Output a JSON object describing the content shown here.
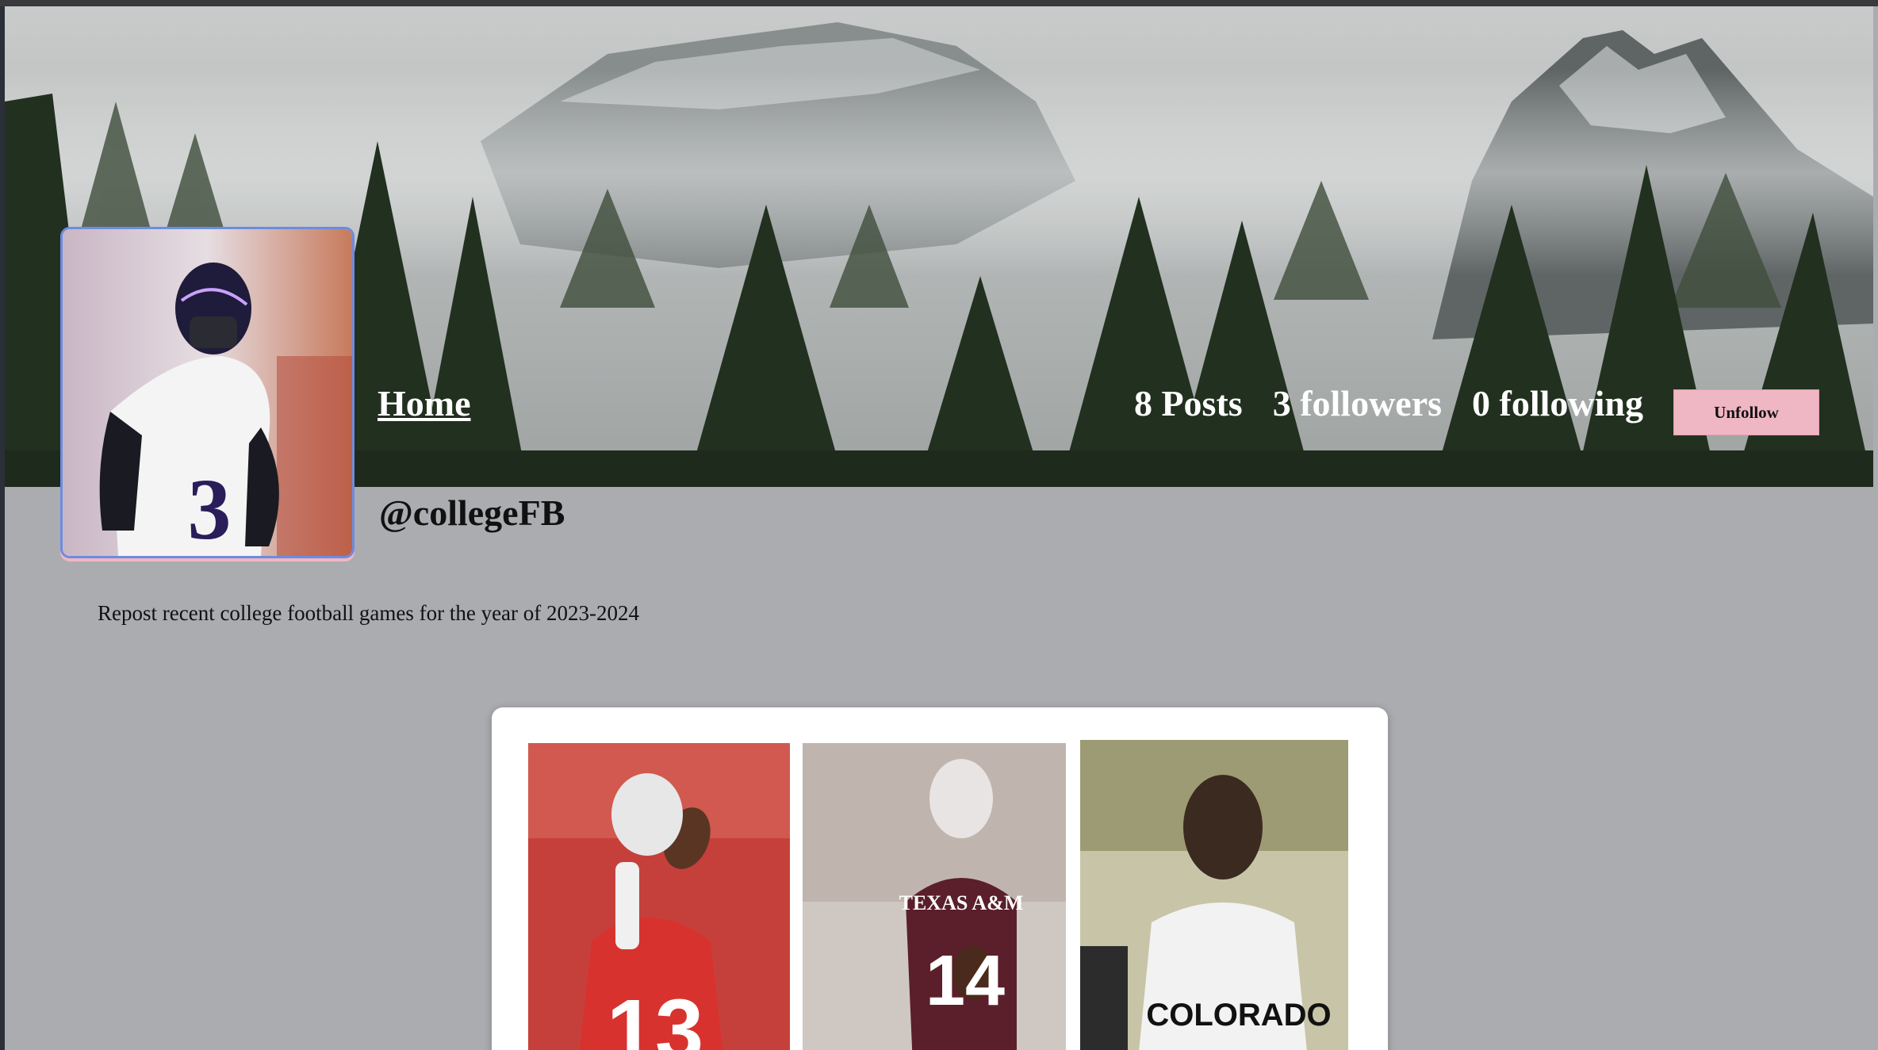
{
  "nav": {
    "home_label": "Home"
  },
  "profile": {
    "username": "@collegeFB",
    "bio": "Repost recent college football games for the year of 2023-2024",
    "posts_count_label": "8 Posts",
    "followers_label": "3 followers",
    "following_label": "0 following",
    "unfollow_label": "Unfollow"
  },
  "posts": [
    {
      "jersey_number": "13",
      "team_text": ""
    },
    {
      "jersey_number": "14",
      "team_text": "TEXAS A&M"
    },
    {
      "jersey_number": "",
      "team_text": "COLORADO"
    }
  ],
  "colors": {
    "background": "#abacb0",
    "unfollow_button": "#efb6c3",
    "avatar_border": "#6c8ce0",
    "text_light": "#ffffff",
    "text_dark": "#111111"
  }
}
